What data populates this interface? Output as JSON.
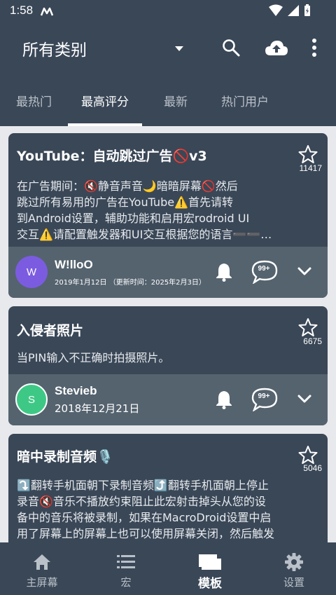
{
  "status_bar": {
    "time": "1:58"
  },
  "app_bar": {
    "title": "所有类别",
    "icons": [
      "dropdown-arrow",
      "search-icon",
      "cloud-upload-icon",
      "more-vert-icon"
    ]
  },
  "tabs": [
    {
      "label": "最热门",
      "active": false
    },
    {
      "label": "最高评分",
      "active": true
    },
    {
      "label": "最新",
      "active": false
    },
    {
      "label": "热门用户",
      "active": false
    }
  ],
  "cards": [
    {
      "title": "YouTube：自动跳过广告🚫v3",
      "stars": "11417",
      "description": "在广告期间：🔇静音声音🌙暗暗屏幕🚫然后\n跳过所有易用的广告在YouTube⚠️首先请转\n到Android设置，辅助功能和启用宏rodroid UI\n交互⚠️请配置触发器和UI交互根据您的语言➖➖…",
      "avatar_letter": "W",
      "avatar_color": "#7b5ce0",
      "username": "W!lloO",
      "date": "2019年1月12日 （更新时间：2025年2月3日）",
      "comments_badge": "99+"
    },
    {
      "title": "入侵者照片",
      "stars": "6675",
      "description": "当PIN输入不正确时拍摄照片。",
      "avatar_letter": "S",
      "avatar_color": "#3ec886",
      "username": "Stevieb",
      "date": "2018年12月21日",
      "comments_badge": "99+"
    },
    {
      "title": "暗中录制音频🎙️",
      "stars": "5046",
      "description": "⤵️翻转手机面朝下录制音频⤴️翻转手机面朝上停止\n录音🔇音乐不播放约束阻止此宏射击掉头从您的设\n备中的音乐将被录制，如果在MacroDroid设置中启\n用了屏幕上的屏幕上也可以使用屏幕关闭，然后触发"
    }
  ],
  "bottom_nav": [
    {
      "label": "主屏幕",
      "icon": "home-icon",
      "active": false
    },
    {
      "label": "宏",
      "icon": "list-icon",
      "active": false
    },
    {
      "label": "模板",
      "icon": "templates-icon",
      "active": true
    },
    {
      "label": "设置",
      "icon": "gear-icon",
      "active": false
    }
  ],
  "colors": {
    "primary": "#3a4757",
    "card_footer": "#55636f",
    "background": "#e8e9ec"
  }
}
